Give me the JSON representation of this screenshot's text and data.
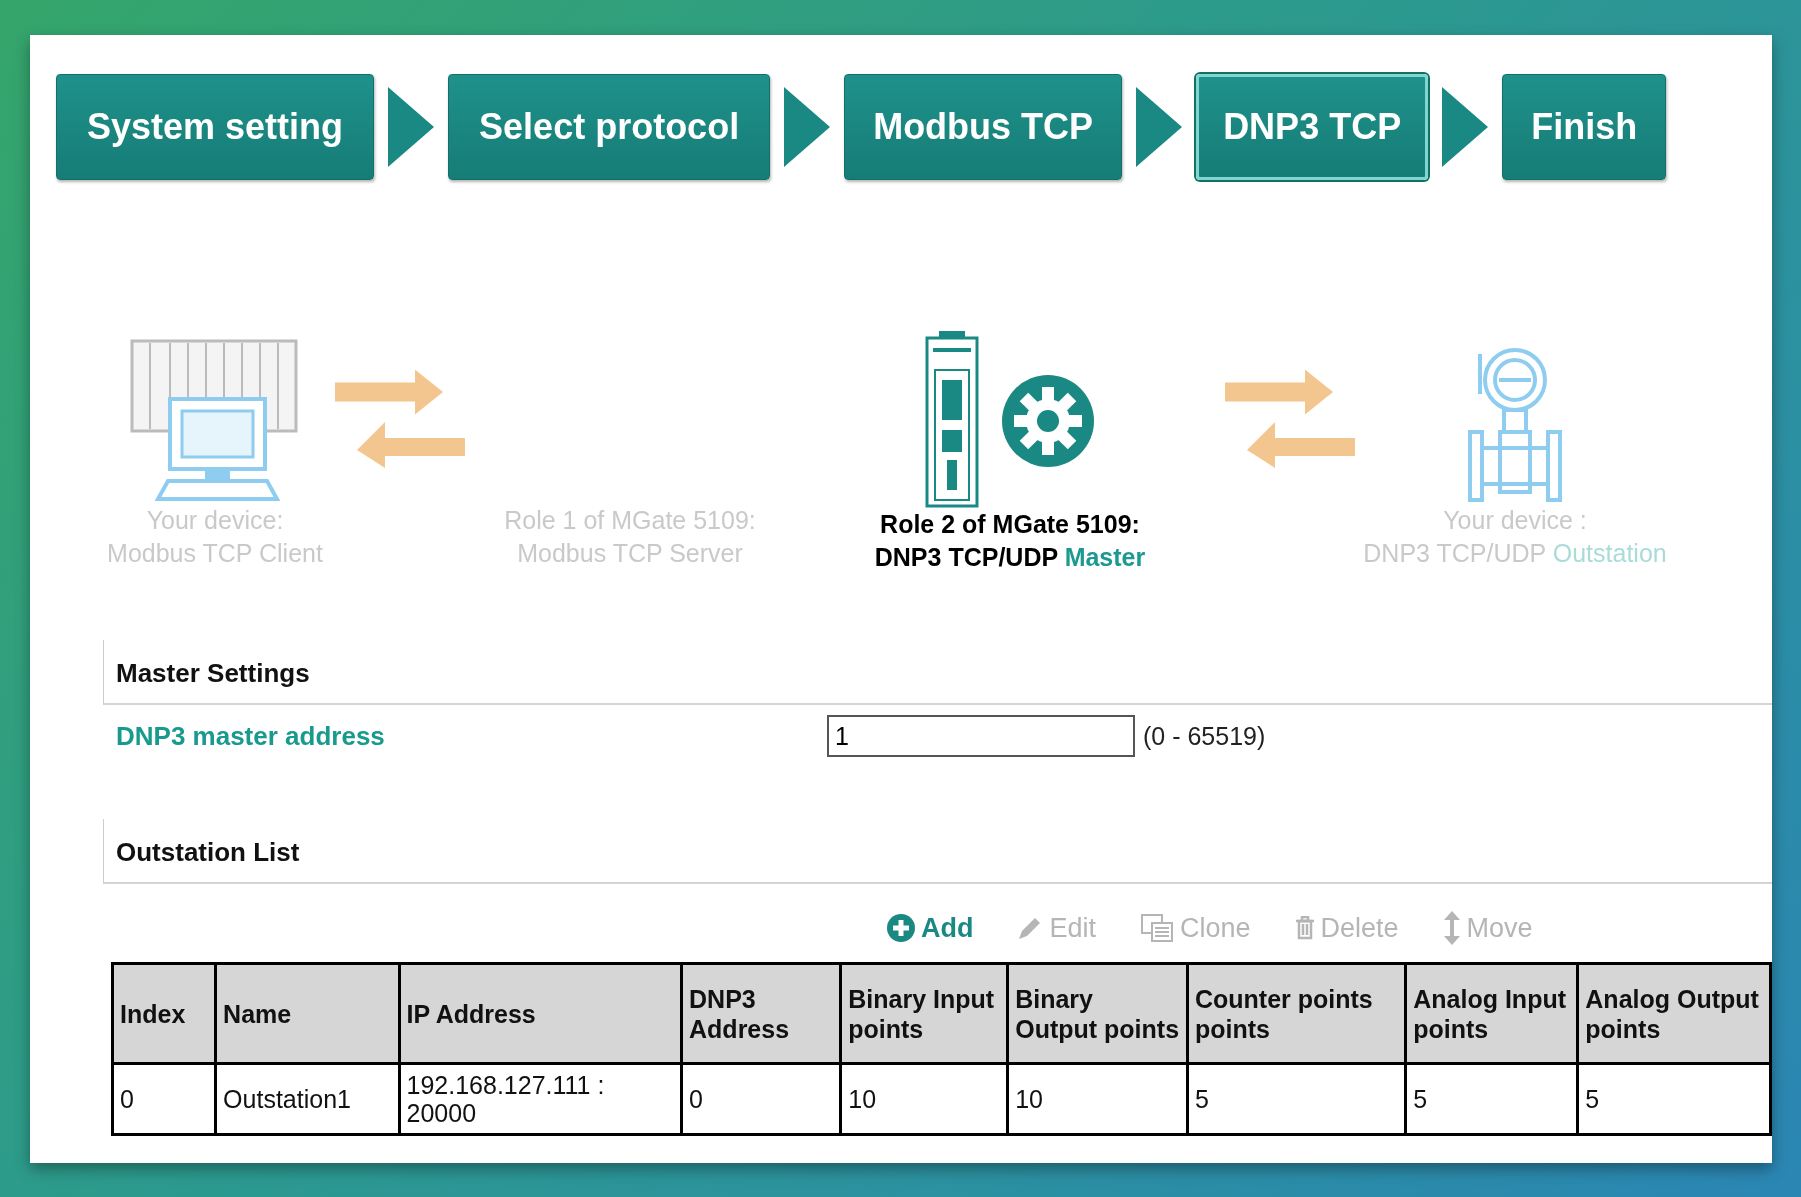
{
  "steps": [
    {
      "label": "System setting",
      "selected": false
    },
    {
      "label": "Select protocol",
      "selected": false
    },
    {
      "label": "Modbus TCP",
      "selected": false
    },
    {
      "label": "DNP3 TCP",
      "selected": true
    },
    {
      "label": "Finish",
      "selected": false
    }
  ],
  "roles": [
    {
      "kind": "client",
      "line1": "Your device:",
      "line2": "Modbus TCP Client",
      "active": false
    },
    {
      "kind": "server",
      "line1": "Role 1 of MGate 5109:",
      "line2": "Modbus TCP Server",
      "active": false
    },
    {
      "kind": "gateway",
      "line1": "Role 2 of MGate 5109:",
      "line2": "DNP3 TCP/UDP",
      "highlight": "Master",
      "active": true
    },
    {
      "kind": "outstation",
      "line1": "Your device :",
      "line2": "DNP3 TCP/UDP",
      "highlight": "Outstation",
      "active": false
    }
  ],
  "master_settings": {
    "title": "Master Settings",
    "label": "DNP3 master address",
    "value": "1",
    "range": "(0 - 65519)"
  },
  "outstation_list": {
    "title": "Outstation List",
    "toolbar": [
      {
        "kind": "add",
        "label": "Add",
        "disabled": false
      },
      {
        "kind": "edit",
        "label": "Edit",
        "disabled": true
      },
      {
        "kind": "clone",
        "label": "Clone",
        "disabled": true
      },
      {
        "kind": "delete",
        "label": "Delete",
        "disabled": true
      },
      {
        "kind": "move",
        "label": "Move",
        "disabled": true
      }
    ],
    "columns": [
      "Index",
      "Name",
      "IP Address",
      "DNP3 Address",
      "Binary Input points",
      "Binary Output points",
      "Counter points points",
      "Analog Input points",
      "Analog Output points"
    ],
    "rows": [
      [
        "0",
        "Outstation1",
        "192.168.127.111 : 20000",
        "0",
        "10",
        "10",
        "5",
        "5",
        "5"
      ]
    ]
  }
}
